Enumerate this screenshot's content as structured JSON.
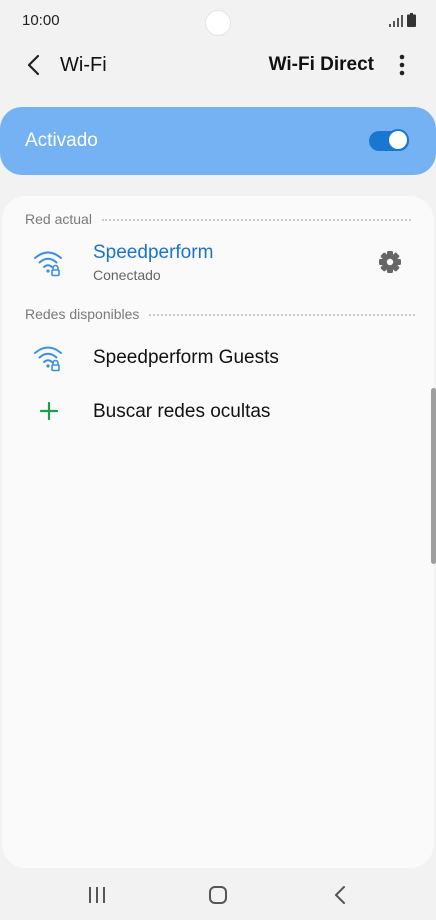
{
  "status_bar": {
    "time": "10:00"
  },
  "app_bar": {
    "title": "Wi-Fi",
    "action_label": "Wi-Fi Direct"
  },
  "master_toggle": {
    "label": "Activado",
    "state": "on",
    "track_color": "#1977d2",
    "card_color": "#74b2f3"
  },
  "current_network": {
    "section_title": "Red actual",
    "name": "Speedperform",
    "status": "Conectado",
    "icon": "wifi-lock-icon",
    "settings_icon": "gear-icon"
  },
  "available_networks": {
    "section_title": "Redes disponibles",
    "items": [
      {
        "name": "Speedperform Guests",
        "icon": "wifi-lock-icon"
      },
      {
        "name": "Buscar redes ocultas",
        "icon": "plus-icon"
      }
    ]
  },
  "nav_bar": {
    "icons": [
      "recents-icon",
      "home-icon",
      "back-icon"
    ]
  },
  "colors": {
    "accent": "#1a73d1",
    "add_icon": "#1e9e4a"
  }
}
